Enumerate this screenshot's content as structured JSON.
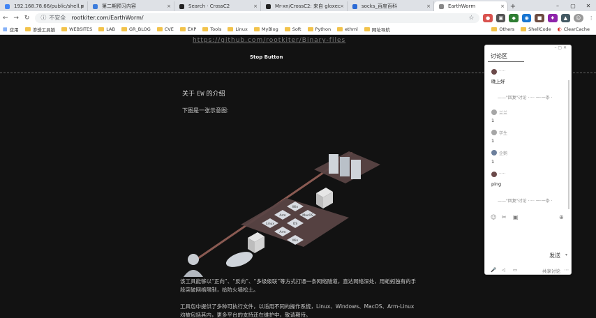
{
  "tabs": [
    {
      "title": "192.168.78.66/public/shell.p",
      "color": "#4285f4"
    },
    {
      "title": "第二期预习内容",
      "color": "#3c7cdc"
    },
    {
      "title": "Search · CrossC2",
      "color": "#222222"
    },
    {
      "title": "Mr-xn/CrossC2: 来自 gloxec",
      "color": "#222222"
    },
    {
      "title": "socks_百度百科",
      "color": "#2a6ad6"
    },
    {
      "title": "EarthWorm",
      "color": "#888888"
    }
  ],
  "address": {
    "insecure": "不安全",
    "url": "rootkiter.com/EarthWorm/"
  },
  "bookmarks": [
    "应用",
    "渗透工具链",
    "WEBSITES",
    "LAB",
    "GR_BLOG",
    "CVE",
    "EXP",
    "Tools",
    "Linux",
    "MyBlog",
    "Soft",
    "Python",
    "ethml",
    "网址导航"
  ],
  "bookmarks_right": [
    "Others",
    "ShellCode",
    "ClearCache"
  ],
  "page": {
    "link": "https://github.com/rootkiter/Binary-files",
    "stop_button": "Stop Button",
    "about_prefix": "关于 ",
    "about_code": "EW",
    "about_suffix": " 的介绍",
    "intro": "下图是一张示意图:",
    "desc": "该工具能够以“正向”、“反向”、“多级级联”等方式打通一条网络隧道，直达网络深处，用蚯蚓独有的手段突破网络限制，给防火墙松土。",
    "tools": "工具包中提供了多种可执行文件，以适用不同的操作系统，Linux、Windows、MacOS、Arm-Linux 均被包括其内，更多平台的支持还在维护中，敬请期待。"
  },
  "diagram": {
    "os_labels": [
      "Linux",
      "Arm",
      "Win",
      "Arm",
      "OS",
      "MacOS",
      "Win"
    ]
  },
  "panel": {
    "title": "讨论区",
    "comments": [
      {
        "user": "·····",
        "text": "晚上好",
        "avatar": "#6b4a4a"
      },
      {
        "reply": "——\"回复\"讨论 ····· 一·一条 ·"
      },
      {
        "user": "兰兰",
        "text": "1",
        "avatar": "#a6a6a6"
      },
      {
        "user": "学生",
        "text": "1",
        "avatar": "#a6a6a6"
      },
      {
        "user": "企鹅",
        "text": "1",
        "avatar": "#6c7f9c"
      },
      {
        "user": "·····",
        "text": "ping",
        "avatar": "#6b4a4a"
      },
      {
        "reply": "——\"回复\"讨论 ····· 一·一条 ·"
      }
    ],
    "send": "发送",
    "bottom": "共享讨论"
  }
}
